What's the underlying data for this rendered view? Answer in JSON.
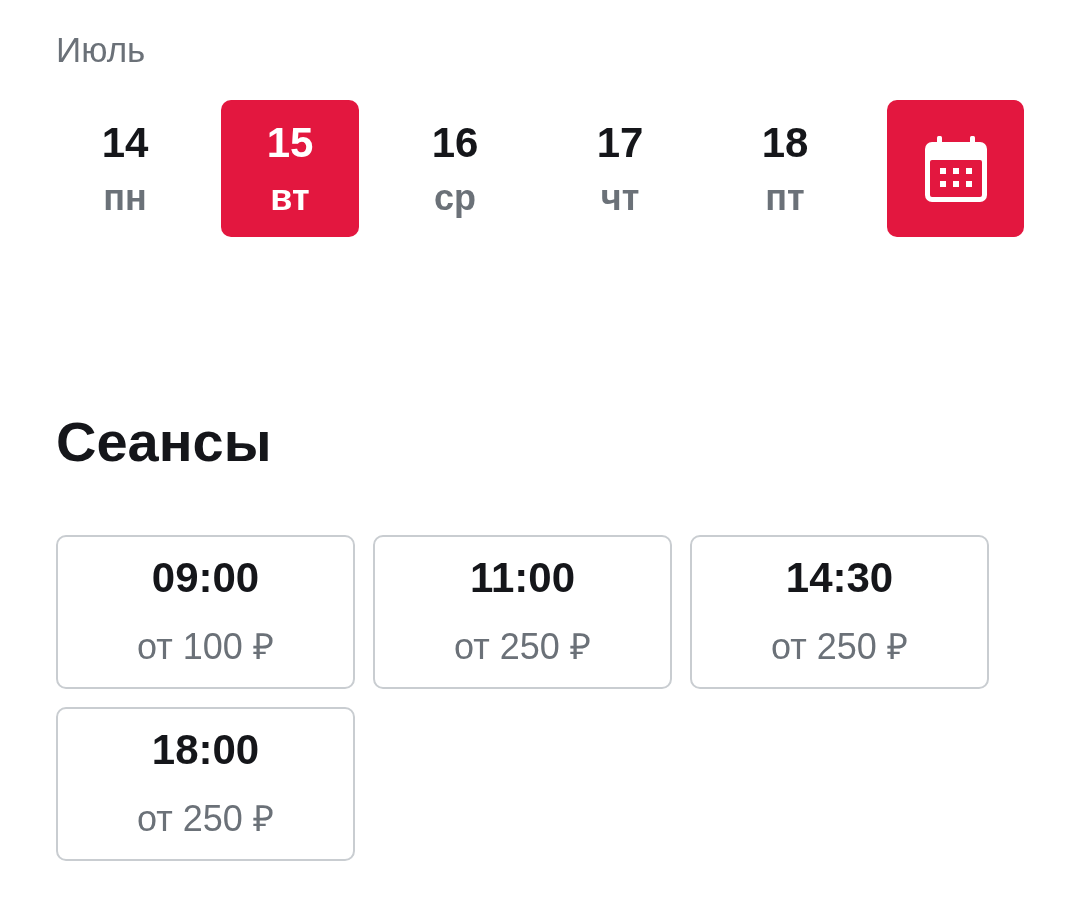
{
  "month": "Июль",
  "days": [
    {
      "number": "14",
      "weekday": "пн",
      "selected": false
    },
    {
      "number": "15",
      "weekday": "вт",
      "selected": true
    },
    {
      "number": "16",
      "weekday": "ср",
      "selected": false
    },
    {
      "number": "17",
      "weekday": "чт",
      "selected": false
    },
    {
      "number": "18",
      "weekday": "пт",
      "selected": false
    }
  ],
  "sessions": {
    "title": "Сеансы",
    "items": [
      {
        "time": "09:00",
        "price": "от 100 ₽"
      },
      {
        "time": "11:00",
        "price": "от 250 ₽"
      },
      {
        "time": "14:30",
        "price": "от 250 ₽"
      },
      {
        "time": "18:00",
        "price": "от 250 ₽"
      }
    ]
  }
}
